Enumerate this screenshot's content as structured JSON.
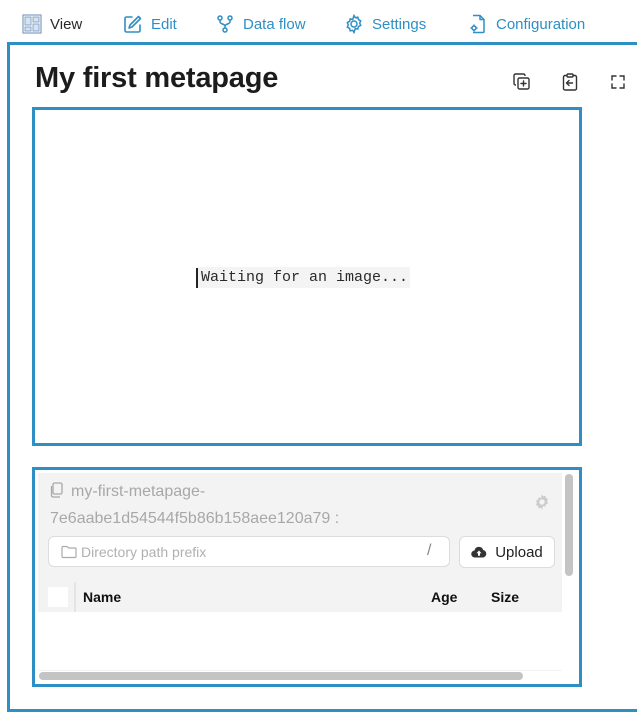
{
  "nav": {
    "view": {
      "label": "View",
      "icon": "layout-icon"
    },
    "edit": {
      "label": "Edit",
      "icon": "edit-icon"
    },
    "dataflow": {
      "label": "Data flow",
      "icon": "data-flow-icon"
    },
    "settings": {
      "label": "Settings",
      "icon": "gear-icon"
    },
    "configuration": {
      "label": "Configuration",
      "icon": "file-settings-icon"
    }
  },
  "page": {
    "title": "My first metapage",
    "toolbar_icons": [
      "copy-add-icon",
      "clipboard-paste-icon",
      "fullscreen-icon"
    ]
  },
  "image_viewer": {
    "status": "Waiting for an image..."
  },
  "file_browser": {
    "name_line_1": "my-first-metapage-",
    "name_line_2": "7e6aabe1d54544f5b86b158aee120a79 :",
    "prefix_placeholder": "Directory path prefix",
    "prefix_value": "",
    "separator": "/",
    "upload_label": "Upload",
    "columns": [
      "Name",
      "Age",
      "Size"
    ],
    "rows": []
  },
  "colors": {
    "accent": "#2e8fc4",
    "text": "#1c1c1c",
    "muted": "#a8a8a8",
    "panel_bg": "#f3f3f3"
  }
}
